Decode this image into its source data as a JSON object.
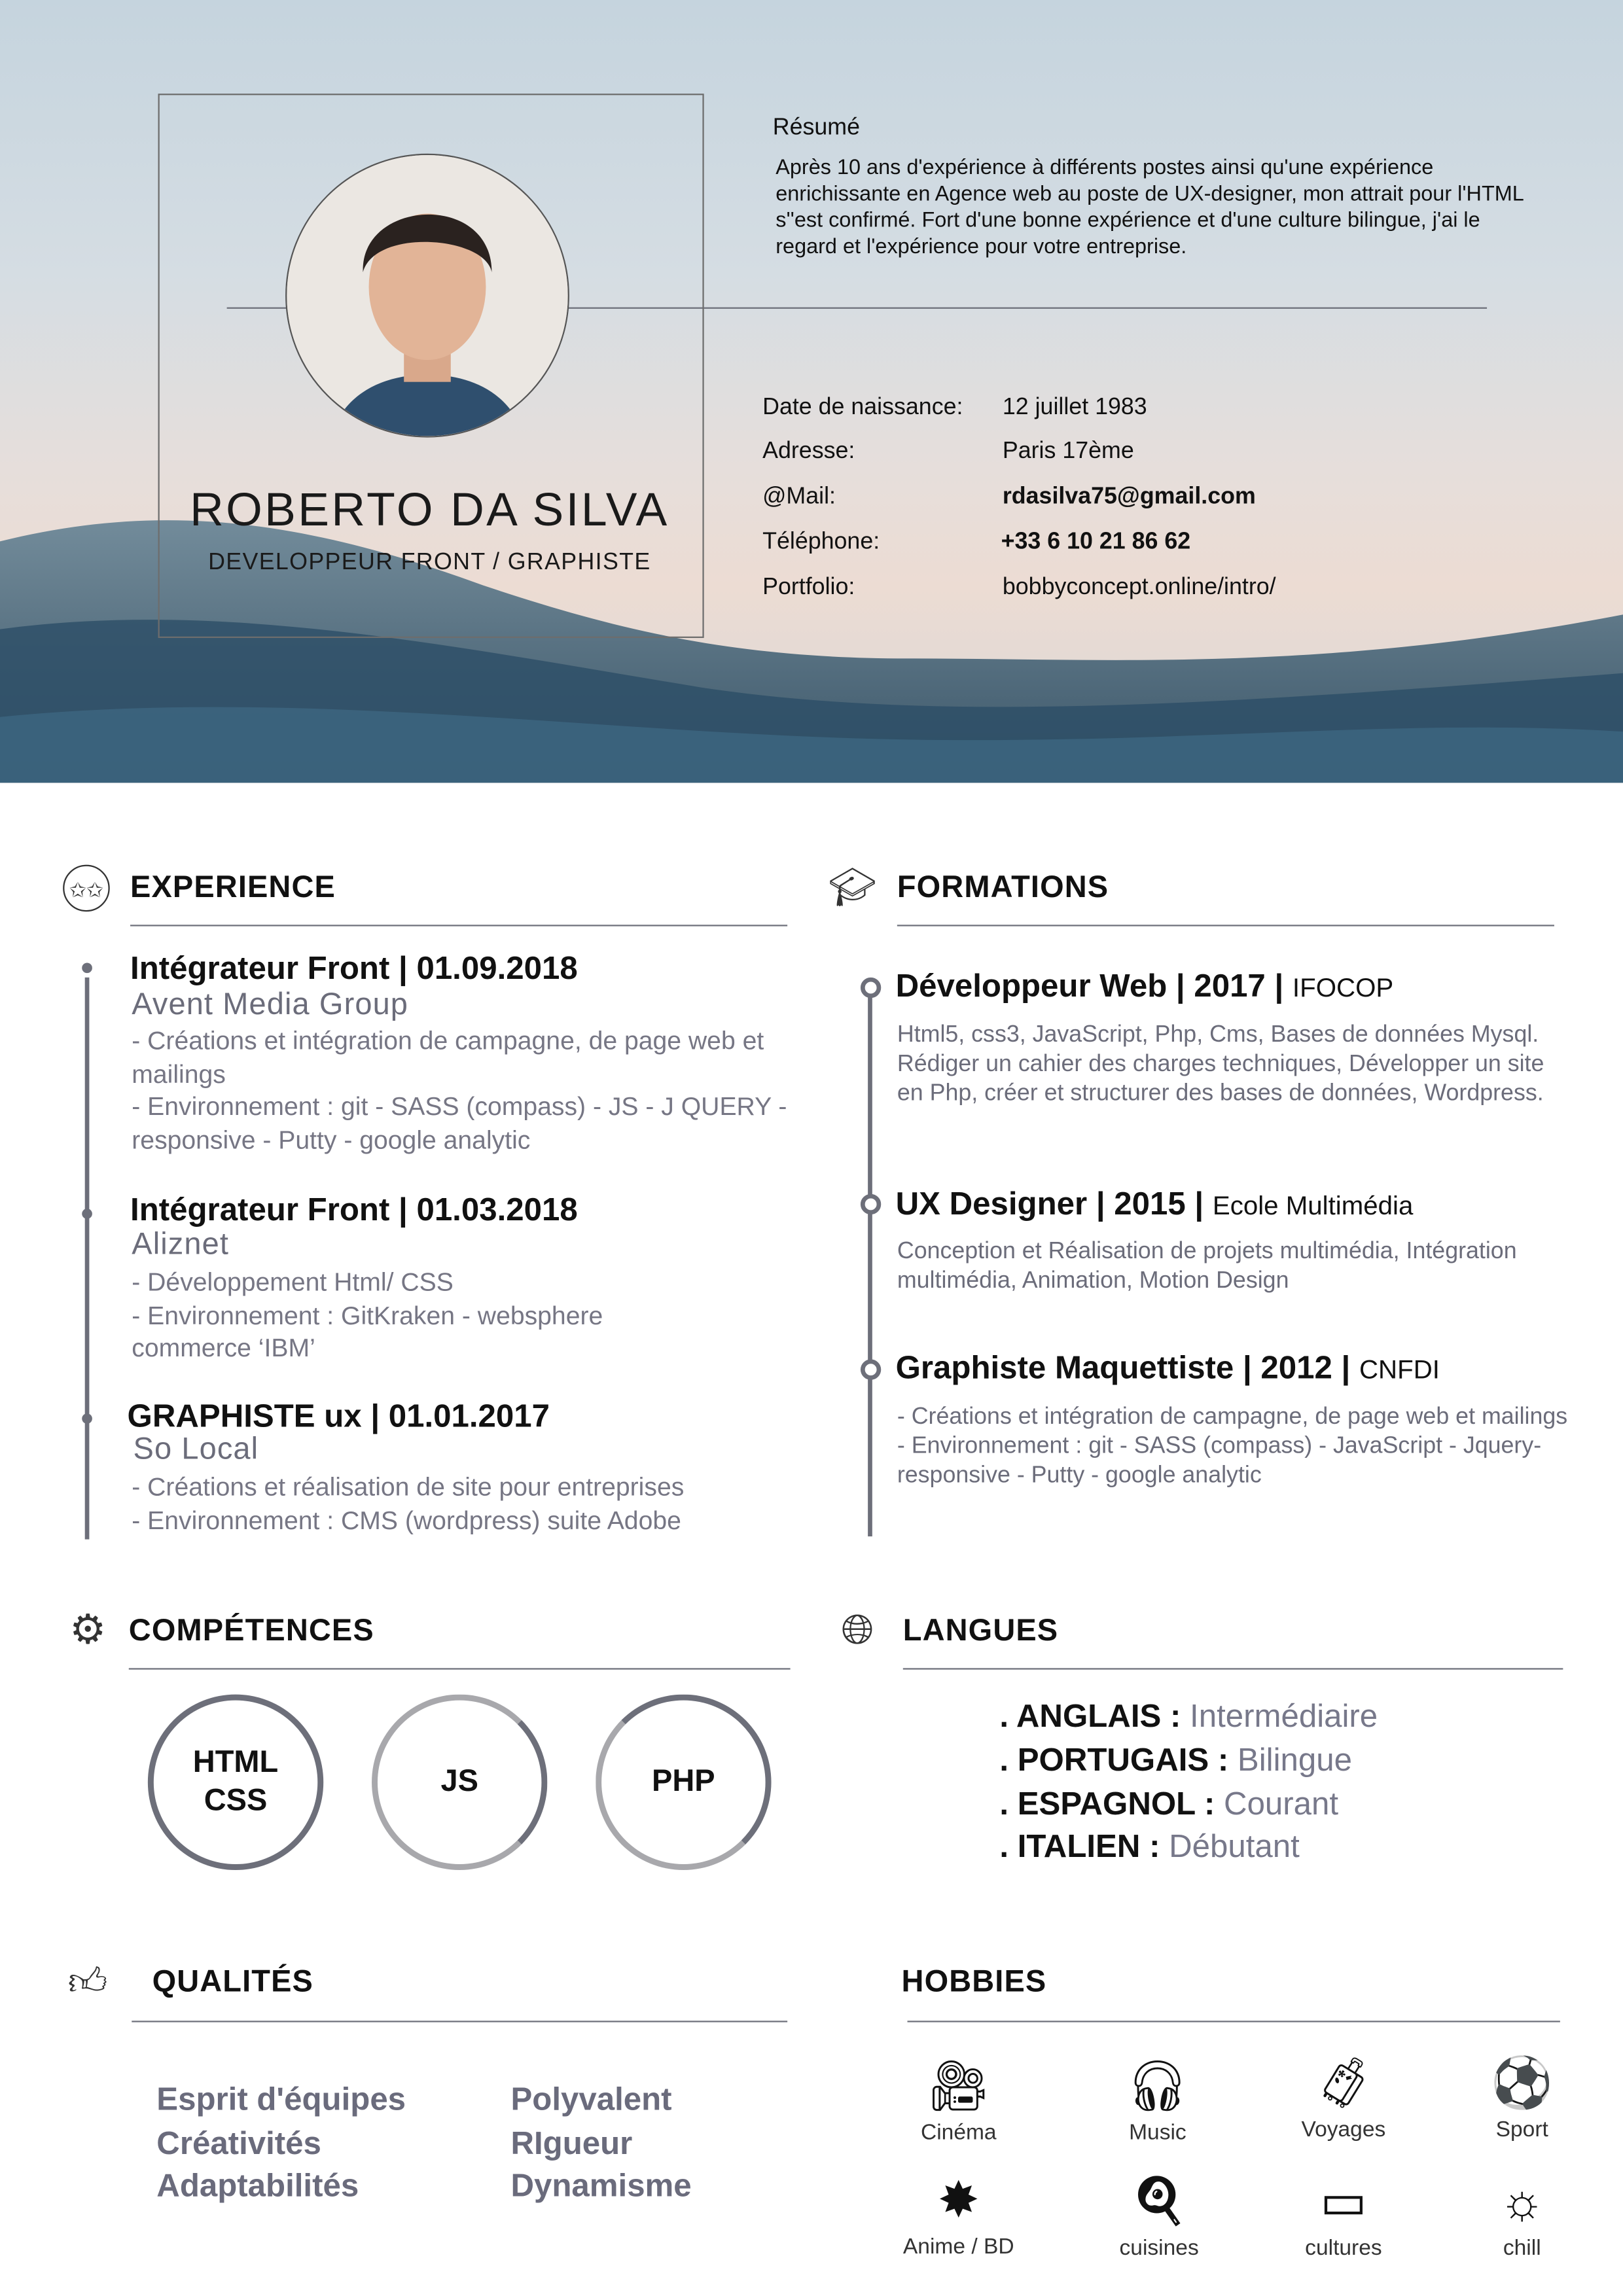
{
  "header": {
    "name": "ROBERTO DA SILVA",
    "subtitle": "DEVELOPPEUR FRONT / GRAPHISTE",
    "resume_title": "Résumé",
    "resume_text": "Après 10 ans d'expérience à différents postes ainsi qu'une expérience enrichissante en Agence web au poste de UX-designer, mon attrait pour l'HTML s''est confirmé. Fort d'une bonne expérience et d'une culture bilingue, j'ai le regard et l'expérience pour votre entreprise.",
    "info": [
      {
        "label": "Date de naissance:",
        "value": "12 juillet 1983"
      },
      {
        "label": "Adresse:",
        "value": "Paris 17ème"
      },
      {
        "label": "@Mail:",
        "value": "rdasilva75@gmail.com"
      },
      {
        "label": "Téléphone:",
        "value": "+33 6 10 21 86 62"
      },
      {
        "label": "Portfolio:",
        "value": "bobbyconcept.online/intro/"
      }
    ]
  },
  "experience": {
    "title": "EXPERIENCE",
    "items": [
      {
        "title": "Intégrateur  Front | 01.09.2018",
        "company": "Avent Media Group",
        "desc": [
          "- Créations et intégration de campagne,   de page web et mailings",
          "- Environnement  :  git - SASS (compass) - JS - J QUERY - responsive - Putty - google analytic"
        ]
      },
      {
        "title": "Intégrateur  Front | 01.03.2018",
        "company": "Aliznet",
        "desc": [
          "- Développement Html/ CSS",
          "- Environnement  :  GitKraken - websphere commerce ‘IBM’"
        ]
      },
      {
        "title": "GRAPHISTE ux | 01.01.2017",
        "company": "So Local",
        "desc": [
          "- Créations et réalisation de site pour entreprises",
          "- Environnement  :  CMS (wordpress) suite Adobe"
        ]
      }
    ]
  },
  "formations": {
    "title": "FORMATIONS",
    "items": [
      {
        "title": "Développeur Web | 2017 | ",
        "school": "IFOCOP",
        "desc": "Html5, css3, JavaScript, Php, Cms, Bases de données Mysql. Rédiger un cahier des charges techniques, Développer un site en Php, créer et structurer des bases de données, Wordpress."
      },
      {
        "title": "UX Designer | 2015 | ",
        "school": "Ecole Multimédia",
        "desc": "Conception et Réalisation de projets multimédia, Intégration multimédia, Animation, Motion Design"
      },
      {
        "title": "Graphiste Maquettiste | 2012 | ",
        "school": "CNFDI",
        "desc": "- Créations et intégration de campagne,   de page web et mailings\n- Environnement  :  git - SASS (compass) - JavaScript - Jquery- responsive - Putty - google analytic"
      }
    ]
  },
  "competences": {
    "title": "COMPÉTENCES",
    "skills": [
      "HTML\nCSS",
      "JS",
      "PHP"
    ]
  },
  "langues": {
    "title": "LANGUES",
    "items": [
      {
        "name": ". ANGLAIS : ",
        "level": "Intermédiaire"
      },
      {
        "name": ". PORTUGAIS : ",
        "level": "Bilingue"
      },
      {
        "name": ". ESPAGNOL : ",
        "level": "Courant"
      },
      {
        "name": ". ITALIEN : ",
        "level": "Débutant"
      }
    ]
  },
  "qualites": {
    "title": "QUALITÉS",
    "items": [
      "Esprit d'équipes",
      "Créativités",
      "Adaptabilités",
      "Polyvalent",
      "RIgueur",
      "Dynamisme"
    ]
  },
  "hobbies": {
    "title": "HOBBIES",
    "items": [
      "Cinéma",
      "Music",
      "Voyages",
      "Sport",
      "Anime / BD",
      "cuisines",
      "cultures",
      "chill"
    ]
  },
  "colors": {
    "accent": "#6d6f7a",
    "muted_text": "#767684"
  }
}
